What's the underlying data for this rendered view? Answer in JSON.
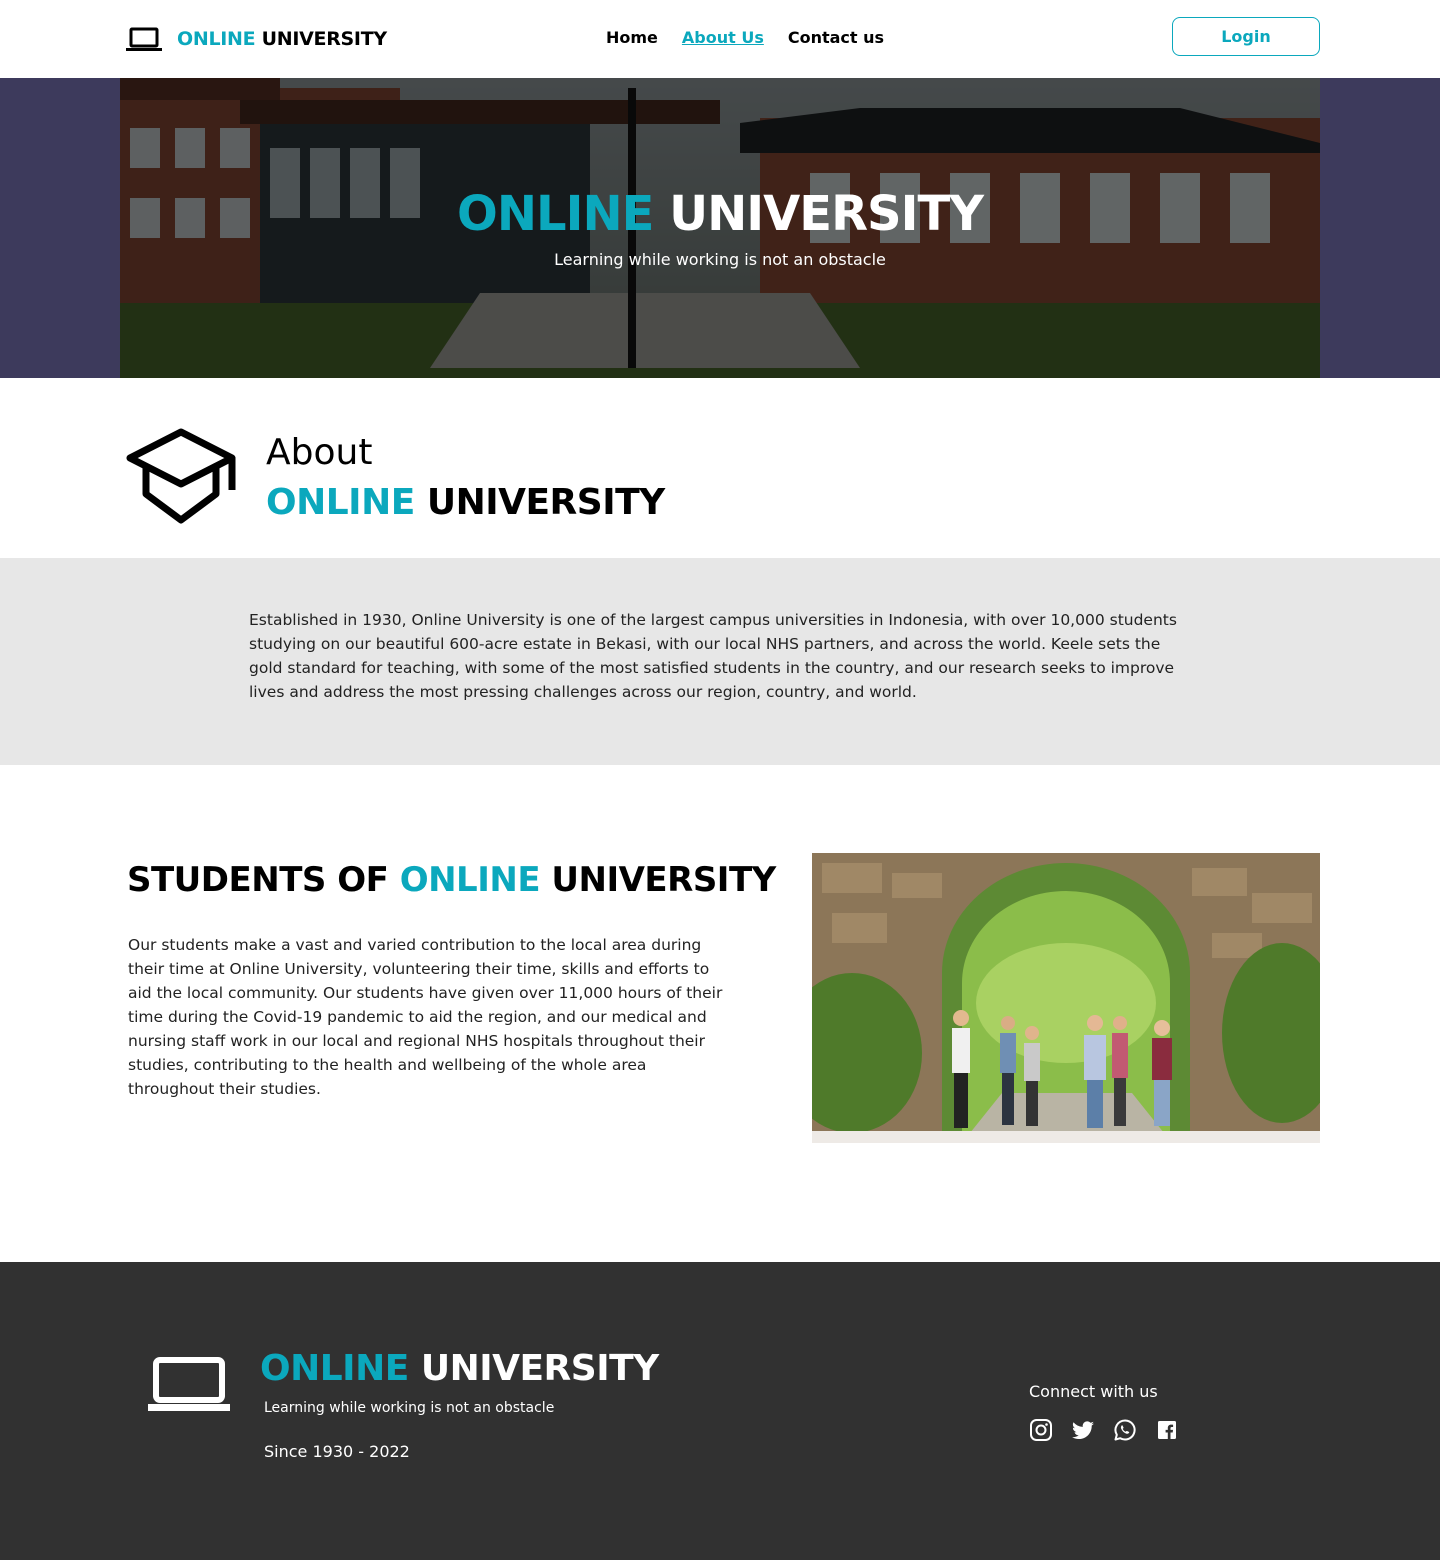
{
  "brand": {
    "accent_word": "ONLINE",
    "rest": " UNIVERSITY",
    "icon": "laptop-icon"
  },
  "nav": {
    "links": [
      "Home",
      "About Us",
      "Contact us"
    ],
    "active": "About Us",
    "login": "Login"
  },
  "hero": {
    "accent_word": "ONLINE",
    "rest": " UNIVERSITY",
    "subtitle": "Learning while working is not an obstacle"
  },
  "about": {
    "label": "About",
    "accent_word": "ONLINE",
    "rest": " UNIVERSITY",
    "icon": "graduation-cap-icon",
    "text": "Established in 1930, Online University is one of the largest campus universities in Indonesia, with over 10,000 students studying on our beautiful 600-acre estate in Bekasi, with our local NHS partners, and across the world. Keele sets the gold standard for teaching, with some of the most satisfied students in the country, and our research seeks to improve lives and address the most pressing challenges across our region, country, and world."
  },
  "students": {
    "prefix": "STUDENTS OF ",
    "accent_word": "ONLINE",
    "rest": " UNIVERSITY",
    "text": "Our students make a vast and varied contribution to the local area during their time at Online University, volunteering their time, skills and efforts to aid the local community. Our students have given over 11,000 hours of their time during the Covid-19 pandemic to aid the region, and our medical and nursing staff work in our local and regional NHS hospitals throughout their studies, contributing to the health and wellbeing of the whole area throughout their studies."
  },
  "footer": {
    "accent_word": "ONLINE",
    "rest": " UNIVERSITY",
    "subtitle": "Learning while working is not an obstacle",
    "since": "Since 1930 - 2022",
    "connect": "Connect with us",
    "social_icons": [
      "instagram-icon",
      "twitter-icon",
      "whatsapp-icon",
      "facebook-icon"
    ]
  },
  "colors": {
    "accent": "#0ba8bd",
    "hero_band": "#3d3a5c",
    "about_band": "#e7e7e7",
    "footer_bg": "#313131"
  }
}
